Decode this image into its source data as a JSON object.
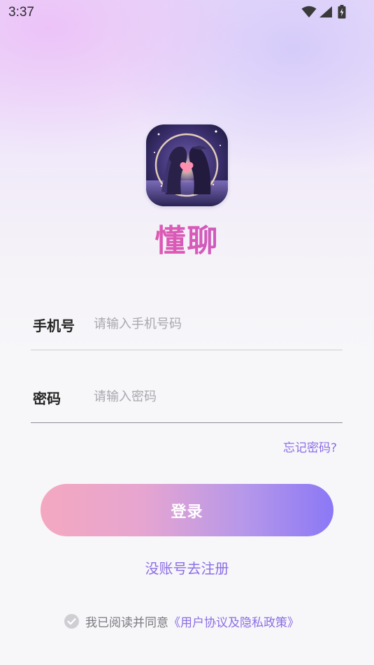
{
  "status_bar": {
    "time": "3:37",
    "icons": [
      "wifi-icon",
      "cell-signal-icon",
      "battery-icon"
    ]
  },
  "app": {
    "name": "懂聊",
    "logo_icon": "couple-logo-icon"
  },
  "form": {
    "phone": {
      "label": "手机号",
      "placeholder": "请输入手机号码",
      "value": ""
    },
    "password": {
      "label": "密码",
      "placeholder": "请输入密码",
      "value": ""
    },
    "forgot_label": "忘记密码?"
  },
  "login_button_label": "登录",
  "register_label": "没账号去注册",
  "agreement": {
    "checked": true,
    "prefix": "我已阅读并同意",
    "link_label": "《用户协议及隐私政策》"
  },
  "colors": {
    "accent": "#8b6ee6",
    "button_start": "#f4a8c0",
    "button_end": "#8b78f5",
    "brand_pink": "#f0549a",
    "brand_purple": "#9c5ee0"
  }
}
